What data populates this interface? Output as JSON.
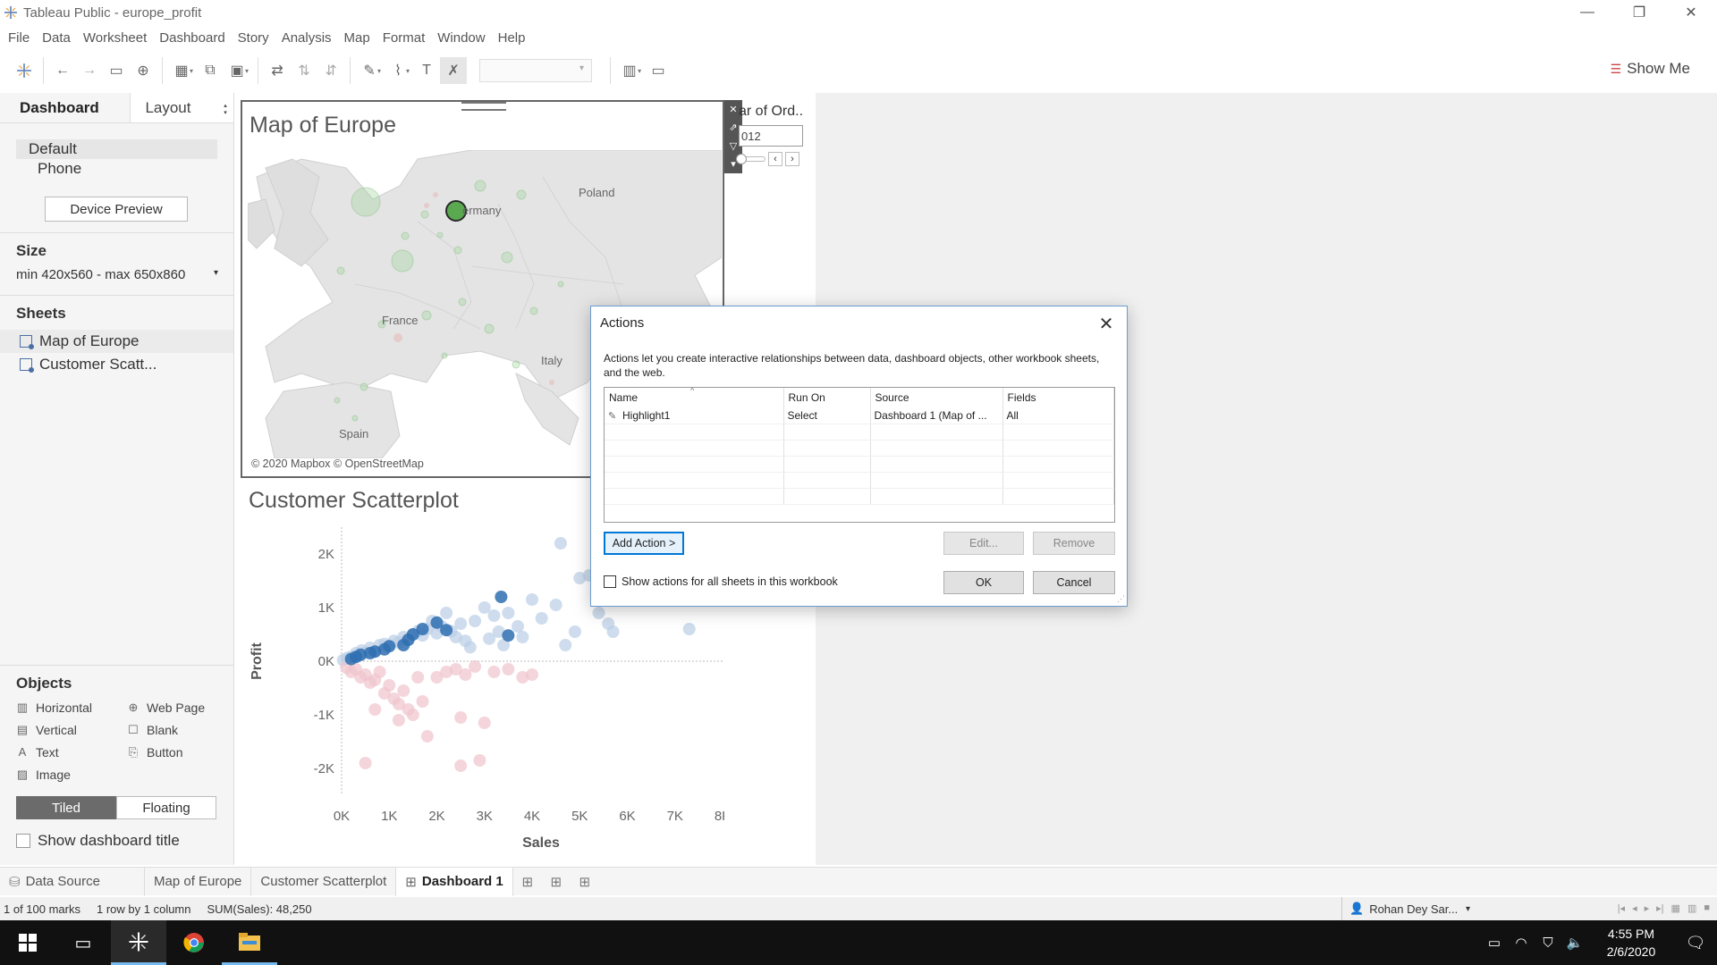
{
  "window": {
    "title": "Tableau Public - europe_profit",
    "controls": {
      "minimize": "—",
      "restore": "❐",
      "close": "✕"
    }
  },
  "menu": [
    "File",
    "Data",
    "Worksheet",
    "Dashboard",
    "Story",
    "Analysis",
    "Map",
    "Format",
    "Window",
    "Help"
  ],
  "toolbar": {
    "show_me": "Show Me",
    "icons": [
      "tableau-logo-icon",
      "undo-icon",
      "redo-icon",
      "save-icon",
      "add-datasource-icon",
      "new-sheet-icon",
      "duplicate-sheet-icon",
      "clear-sheet-icon",
      "swap-icon",
      "sort-ascending-icon",
      "sort-descending-icon",
      "highlight-icon",
      "group-icon",
      "label-icon",
      "fix-axes-icon",
      "fit-icon",
      "presentation-icon"
    ]
  },
  "left_panel": {
    "tabs": {
      "dashboard": "Dashboard",
      "layout": "Layout"
    },
    "devices": {
      "default": "Default",
      "phone": "Phone"
    },
    "device_preview": "Device Preview",
    "size": {
      "title": "Size",
      "value": "min 420x560 - max 650x860"
    },
    "sheets": {
      "title": "Sheets",
      "items": [
        "Map of Europe",
        "Customer Scatt..."
      ]
    },
    "objects": {
      "title": "Objects",
      "items": [
        {
          "label": "Horizontal",
          "icon": "horizontal-container-icon",
          "glyph": "▥"
        },
        {
          "label": "Web Page",
          "icon": "globe-icon",
          "glyph": "⊕"
        },
        {
          "label": "Vertical",
          "icon": "vertical-container-icon",
          "glyph": "▤"
        },
        {
          "label": "Blank",
          "icon": "blank-icon",
          "glyph": "☐"
        },
        {
          "label": "Text",
          "icon": "text-icon",
          "glyph": "A"
        },
        {
          "label": "Button",
          "icon": "button-icon",
          "glyph": "⎘"
        },
        {
          "label": "Image",
          "icon": "image-icon",
          "glyph": "▨"
        }
      ]
    },
    "tiled": "Tiled",
    "floating": "Floating",
    "show_title": "Show dashboard title"
  },
  "map": {
    "title": "Map of Europe",
    "copyright": "© 2020 Mapbox © OpenStreetMap",
    "labels": {
      "poland": "Poland",
      "germany": "ermany",
      "france": "France",
      "italy": "Italy",
      "spain": "Spain"
    }
  },
  "year_filter": {
    "title": "ar of Ord..",
    "value": "012"
  },
  "scatter": {
    "title": "Customer Scatterplot",
    "xlabel": "Sales",
    "ylabel": "Profit"
  },
  "chart_data": {
    "type": "scatter",
    "title": "Customer Scatterplot",
    "xlabel": "Sales",
    "ylabel": "Profit",
    "xlim": [
      0,
      8000
    ],
    "ylim": [
      -2500,
      2500
    ],
    "x_ticks": [
      "0K",
      "1K",
      "2K",
      "3K",
      "4K",
      "5K",
      "6K",
      "7K",
      "8K"
    ],
    "y_ticks": [
      "2K",
      "1K",
      "0K",
      "-1K",
      "-2K"
    ],
    "positive_color": "#2f6fb0",
    "negative_color": "#d98a99",
    "points": [
      {
        "x": 30,
        "y": 20
      },
      {
        "x": 120,
        "y": 60
      },
      {
        "x": 200,
        "y": 80
      },
      {
        "x": 300,
        "y": 150
      },
      {
        "x": 350,
        "y": 100
      },
      {
        "x": 420,
        "y": 200
      },
      {
        "x": 500,
        "y": 160
      },
      {
        "x": 600,
        "y": 250
      },
      {
        "x": 700,
        "y": 180
      },
      {
        "x": 800,
        "y": 300
      },
      {
        "x": 900,
        "y": 320
      },
      {
        "x": 1000,
        "y": 280
      },
      {
        "x": 1100,
        "y": 380
      },
      {
        "x": 1200,
        "y": 350
      },
      {
        "x": 1300,
        "y": 450
      },
      {
        "x": 1400,
        "y": 400
      },
      {
        "x": 1500,
        "y": 500
      },
      {
        "x": 1600,
        "y": 560
      },
      {
        "x": 1700,
        "y": 480
      },
      {
        "x": 1800,
        "y": 600
      },
      {
        "x": 1900,
        "y": 750
      },
      {
        "x": 2000,
        "y": 520
      },
      {
        "x": 2100,
        "y": 650
      },
      {
        "x": 2200,
        "y": 900
      },
      {
        "x": 2300,
        "y": 560
      },
      {
        "x": 2400,
        "y": 450
      },
      {
        "x": 2500,
        "y": 700
      },
      {
        "x": 2600,
        "y": 380
      },
      {
        "x": 2700,
        "y": 260
      },
      {
        "x": 2800,
        "y": 750
      },
      {
        "x": 3000,
        "y": 1000
      },
      {
        "x": 3100,
        "y": 420
      },
      {
        "x": 3200,
        "y": 850
      },
      {
        "x": 3300,
        "y": 550
      },
      {
        "x": 3400,
        "y": 300
      },
      {
        "x": 3500,
        "y": 900
      },
      {
        "x": 3700,
        "y": 650
      },
      {
        "x": 3800,
        "y": 450
      },
      {
        "x": 4000,
        "y": 1150
      },
      {
        "x": 4200,
        "y": 800
      },
      {
        "x": 4500,
        "y": 1050
      },
      {
        "x": 4700,
        "y": 300
      },
      {
        "x": 4900,
        "y": 550
      },
      {
        "x": 5000,
        "y": 1550
      },
      {
        "x": 5200,
        "y": 1600
      },
      {
        "x": 5400,
        "y": 900
      },
      {
        "x": 5600,
        "y": 700
      },
      {
        "x": 5700,
        "y": 550
      },
      {
        "x": 4600,
        "y": 2200
      },
      {
        "x": 7300,
        "y": 600
      },
      {
        "x": 100,
        "y": -120
      },
      {
        "x": 200,
        "y": -200
      },
      {
        "x": 300,
        "y": -150
      },
      {
        "x": 400,
        "y": -300
      },
      {
        "x": 500,
        "y": -250
      },
      {
        "x": 600,
        "y": -400
      },
      {
        "x": 700,
        "y": -350
      },
      {
        "x": 800,
        "y": -200
      },
      {
        "x": 900,
        "y": -600
      },
      {
        "x": 1000,
        "y": -450
      },
      {
        "x": 1100,
        "y": -700
      },
      {
        "x": 1200,
        "y": -800
      },
      {
        "x": 1300,
        "y": -550
      },
      {
        "x": 1400,
        "y": -900
      },
      {
        "x": 1500,
        "y": -1000
      },
      {
        "x": 1600,
        "y": -300
      },
      {
        "x": 1700,
        "y": -750
      },
      {
        "x": 1800,
        "y": -1400
      },
      {
        "x": 2000,
        "y": -300
      },
      {
        "x": 2200,
        "y": -200
      },
      {
        "x": 2400,
        "y": -150
      },
      {
        "x": 2500,
        "y": -1050
      },
      {
        "x": 2600,
        "y": -250
      },
      {
        "x": 2800,
        "y": -100
      },
      {
        "x": 3000,
        "y": -1150
      },
      {
        "x": 3200,
        "y": -200
      },
      {
        "x": 3500,
        "y": -150
      },
      {
        "x": 3800,
        "y": -300
      },
      {
        "x": 500,
        "y": -1900
      },
      {
        "x": 2500,
        "y": -1950
      },
      {
        "x": 2900,
        "y": -1850
      },
      {
        "x": 4000,
        "y": -250
      },
      {
        "x": 1200,
        "y": -1100
      },
      {
        "x": 700,
        "y": -900
      }
    ],
    "highlighted": [
      {
        "x": 3350,
        "y": 1200
      },
      {
        "x": 2000,
        "y": 720
      },
      {
        "x": 2200,
        "y": 580
      },
      {
        "x": 1700,
        "y": 600
      },
      {
        "x": 1400,
        "y": 400
      },
      {
        "x": 1000,
        "y": 280
      },
      {
        "x": 700,
        "y": 180
      },
      {
        "x": 400,
        "y": 120
      },
      {
        "x": 300,
        "y": 80
      },
      {
        "x": 200,
        "y": 40
      },
      {
        "x": 1500,
        "y": 500
      },
      {
        "x": 3500,
        "y": 480
      },
      {
        "x": 1300,
        "y": 300
      },
      {
        "x": 900,
        "y": 220
      },
      {
        "x": 600,
        "y": 150
      }
    ]
  },
  "dialog": {
    "title": "Actions",
    "description": "Actions let you create interactive relationships between data, dashboard objects, other workbook sheets, and the web.",
    "columns": [
      "Name",
      "Run On",
      "Source",
      "Fields"
    ],
    "rows": [
      {
        "name": "Highlight1",
        "run_on": "Select",
        "source": "Dashboard 1 (Map of ...",
        "fields": "All"
      }
    ],
    "add_action": "Add Action >",
    "edit": "Edit...",
    "remove": "Remove",
    "show_all": "Show actions for all sheets in this workbook",
    "ok": "OK",
    "cancel": "Cancel"
  },
  "bottom_tabs": {
    "data_source": "Data Source",
    "tabs": [
      "Map of Europe",
      "Customer Scatterplot"
    ],
    "active": "Dashboard 1"
  },
  "status": {
    "marks": "1 of 100 marks",
    "layout": "1 row by 1 column",
    "sum": "SUM(Sales): 48,250",
    "user": "Rohan Dey Sar..."
  },
  "taskbar": {
    "time": "4:55 PM",
    "date": "2/6/2020"
  }
}
